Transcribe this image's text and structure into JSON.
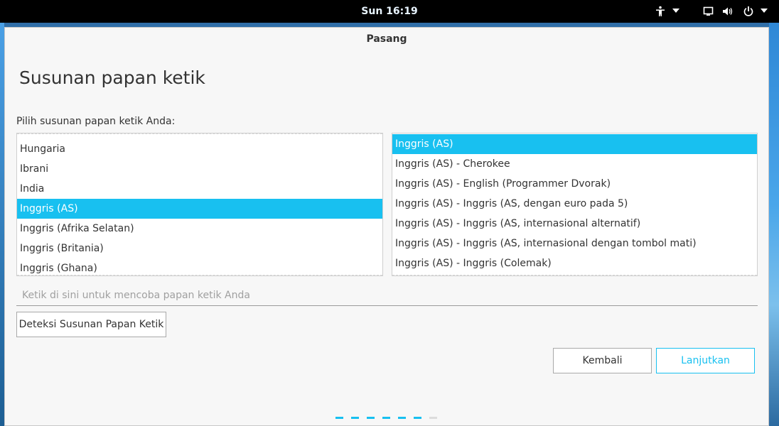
{
  "topbar": {
    "clock": "Sun 16:19",
    "icons": [
      "accessibility-icon",
      "chevron-down-icon",
      "screen-icon",
      "volume-icon",
      "power-icon",
      "chevron-down-icon"
    ]
  },
  "window": {
    "title": "Pasang",
    "heading": "Susunan papan ketik",
    "prompt": "Pilih susunan papan ketik Anda:"
  },
  "layouts": {
    "items": [
      "Hungaria",
      "Ibrani",
      "India",
      "Inggris (AS)",
      "Inggris (Afrika Selatan)",
      "Inggris (Britania)",
      "Inggris (Ghana)"
    ],
    "selected_index": 3
  },
  "variants": {
    "items": [
      "Inggris (AS)",
      "Inggris (AS) - Cherokee",
      "Inggris (AS) - English (Programmer Dvorak)",
      "Inggris (AS) - Inggris (AS, dengan euro pada 5)",
      "Inggris (AS) - Inggris (AS, internasional alternatif)",
      "Inggris (AS) - Inggris (AS, internasional dengan tombol mati)",
      "Inggris (AS) - Inggris (Colemak)"
    ],
    "selected_index": 0
  },
  "test_field": {
    "placeholder": "Ketik di sini untuk mencoba papan ketik Anda",
    "value": ""
  },
  "buttons": {
    "detect": "Deteksi Susunan Papan Ketik",
    "back": "Kembali",
    "next": "Lanjutkan"
  },
  "progress": {
    "total_steps": 7,
    "completed_steps": 6
  },
  "colors": {
    "accent": "#18c0f0",
    "topbar": "#000000",
    "window_bg": "#f7f7f7"
  }
}
